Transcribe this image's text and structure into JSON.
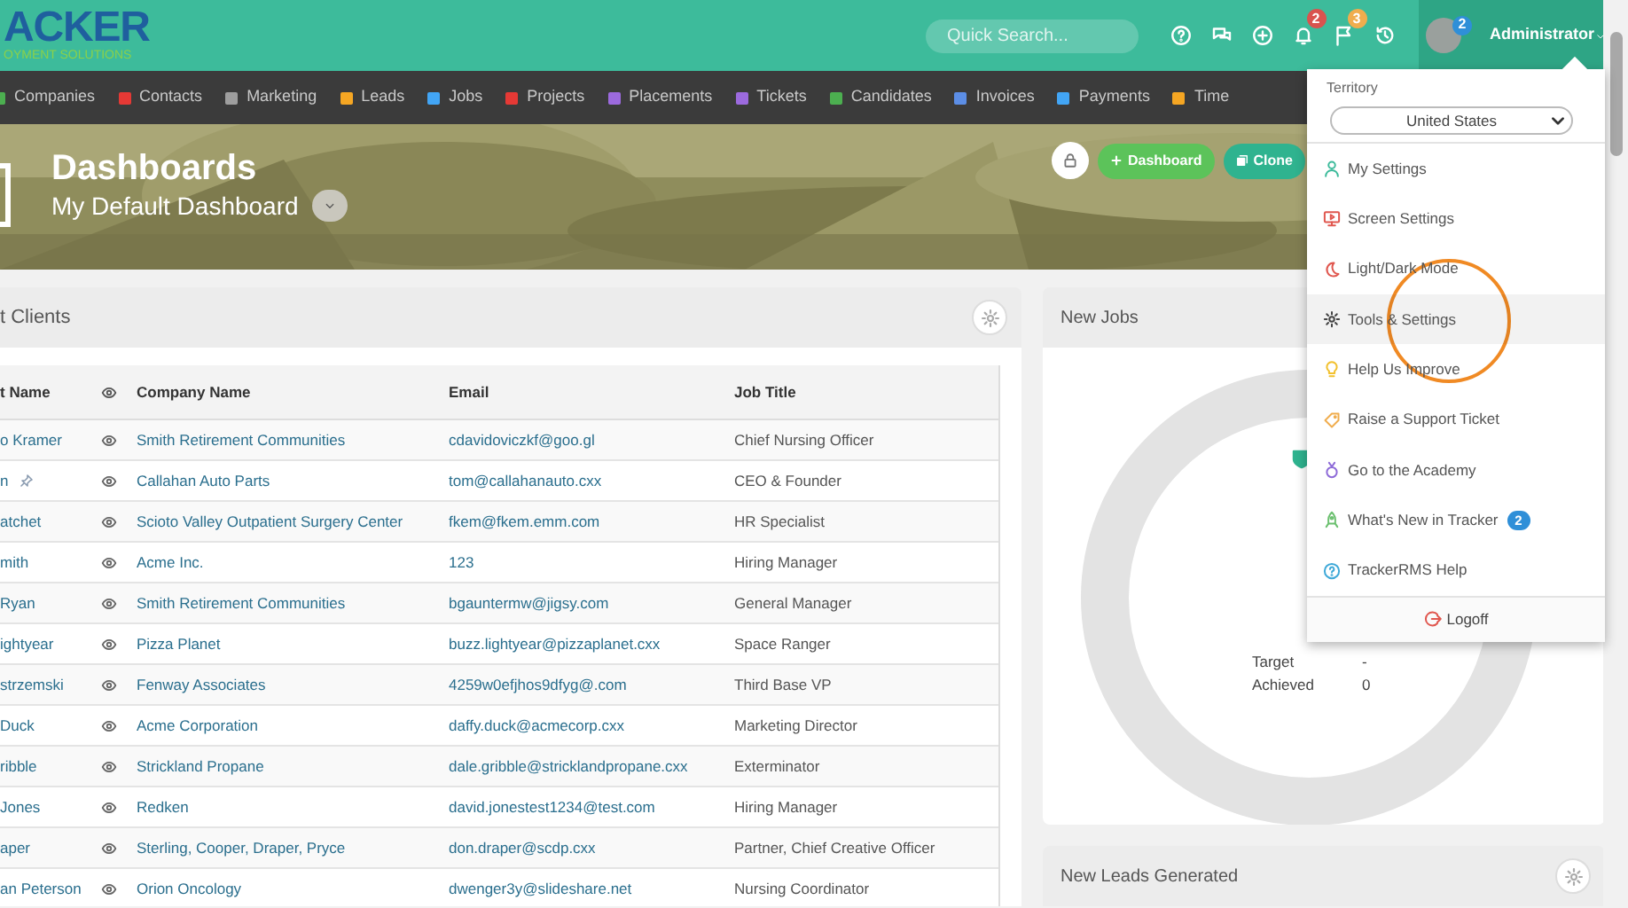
{
  "logo": {
    "word": "ACKER",
    "tagline": "OYMENT SOLUTIONS"
  },
  "search": {
    "placeholder": "Quick Search..."
  },
  "header_icons": [
    {
      "kind": "help"
    },
    {
      "kind": "chat"
    },
    {
      "kind": "add"
    },
    {
      "kind": "bell",
      "badge": "2",
      "color": "#d9534f"
    },
    {
      "kind": "flag",
      "badge": "3",
      "color": "#f0ad4e"
    },
    {
      "kind": "history"
    }
  ],
  "user": {
    "badge": "2",
    "name": "Administrator"
  },
  "nav": [
    {
      "label": "Companies",
      "color": "#4caf50"
    },
    {
      "label": "Contacts",
      "color": "#e53935"
    },
    {
      "label": "Marketing",
      "color": "#9e9e9e"
    },
    {
      "label": "Leads",
      "color": "#f5a623"
    },
    {
      "label": "Jobs",
      "color": "#42a5f5"
    },
    {
      "label": "Projects",
      "color": "#e53935"
    },
    {
      "label": "Placements",
      "color": "#9c6ade"
    },
    {
      "label": "Tickets",
      "color": "#9c6ade"
    },
    {
      "label": "Candidates",
      "color": "#4caf50"
    },
    {
      "label": "Invoices",
      "color": "#5c8ee6"
    },
    {
      "label": "Payments",
      "color": "#42a5f5"
    },
    {
      "label": "Time",
      "color": "#f5a623"
    }
  ],
  "banner": {
    "title": "Dashboards",
    "subtitle": "My Default Dashboard",
    "buttons": [
      {
        "kind": "add",
        "label": "Dashboard"
      },
      {
        "kind": "clone",
        "label": "Clone"
      }
    ]
  },
  "clients_panel": {
    "title": "t Clients",
    "columns": [
      "t Name",
      "Company Name",
      "Email",
      "Job Title"
    ],
    "rows": [
      {
        "name": "o Kramer",
        "pinned": false,
        "company": "Smith Retirement Communities",
        "email": "cdavidoviczkf@goo.gl",
        "job_title": "Chief Nursing Officer"
      },
      {
        "name": "n",
        "pinned": true,
        "company": "Callahan Auto Parts",
        "email": "tom@callahanauto.cxx",
        "job_title": "CEO & Founder"
      },
      {
        "name": "atchet",
        "pinned": false,
        "company": "Scioto Valley Outpatient Surgery Center",
        "email": "fkem@fkem.emm.com",
        "job_title": "HR Specialist"
      },
      {
        "name": "mith",
        "pinned": false,
        "company": "Acme Inc.",
        "email": "123",
        "job_title": "Hiring Manager"
      },
      {
        "name": "Ryan",
        "pinned": false,
        "company": "Smith Retirement Communities",
        "email": "bgauntermw@jigsy.com",
        "job_title": "General Manager"
      },
      {
        "name": "ightyear",
        "pinned": false,
        "company": "Pizza Planet",
        "email": "buzz.lightyear@pizzaplanet.cxx",
        "job_title": "Space Ranger"
      },
      {
        "name": "strzemski",
        "pinned": false,
        "company": "Fenway Associates",
        "email": "4259w0efjhos9dfyg@.com",
        "job_title": "Third Base VP"
      },
      {
        "name": "Duck",
        "pinned": false,
        "company": "Acme Corporation",
        "email": "daffy.duck@acmecorp.cxx",
        "job_title": "Marketing Director"
      },
      {
        "name": "ribble",
        "pinned": false,
        "company": "Strickland Propane",
        "email": "dale.gribble@stricklandpropane.cxx",
        "job_title": "Exterminator"
      },
      {
        "name": "Jones",
        "pinned": false,
        "company": "Redken",
        "email": "david.jonestest1234@test.com",
        "job_title": "Hiring Manager"
      },
      {
        "name": "aper",
        "pinned": false,
        "company": "Sterling, Cooper, Draper, Pryce",
        "email": "don.draper@scdp.cxx",
        "job_title": "Partner, Chief Creative Officer"
      },
      {
        "name": "an Peterson",
        "pinned": false,
        "company": "Orion Oncology",
        "email": "dwenger3y@slideshare.net",
        "job_title": "Nursing Coordinator"
      }
    ]
  },
  "jobs_panel": {
    "title": "New Jobs",
    "stats": [
      {
        "label": "Target",
        "value": "-"
      },
      {
        "label": "Achieved",
        "value": "0"
      }
    ]
  },
  "leads_panel": {
    "title": "New Leads Generated"
  },
  "menu": {
    "territory_label": "Territory",
    "territory": "United States",
    "items": [
      {
        "kind": "person",
        "label": "My Settings",
        "color": "#3dbb9b",
        "selected": false
      },
      {
        "kind": "screen",
        "label": "Screen Settings",
        "color": "#e0574f",
        "selected": false
      },
      {
        "kind": "moon",
        "label": "Light/Dark Mode",
        "color": "#e0574f",
        "selected": false
      },
      {
        "kind": "gear",
        "label": "Tools & Settings",
        "color": "#444444",
        "selected": true
      },
      {
        "kind": "bulb",
        "label": "Help Us Improve",
        "color": "#f2c12e",
        "selected": false
      },
      {
        "kind": "tag",
        "label": "Raise a Support Ticket",
        "color": "#f0ad4e",
        "selected": false
      },
      {
        "kind": "medal",
        "label": "Go to the Academy",
        "color": "#8e6bd8",
        "selected": false
      },
      {
        "kind": "rocket",
        "label": "What's New in Tracker",
        "color": "#6cc070",
        "selected": false,
        "badge": "2"
      },
      {
        "kind": "help",
        "label": "TrackerRMS Help",
        "color": "#3fa9d8",
        "selected": false
      }
    ],
    "logoff": "Logoff"
  }
}
